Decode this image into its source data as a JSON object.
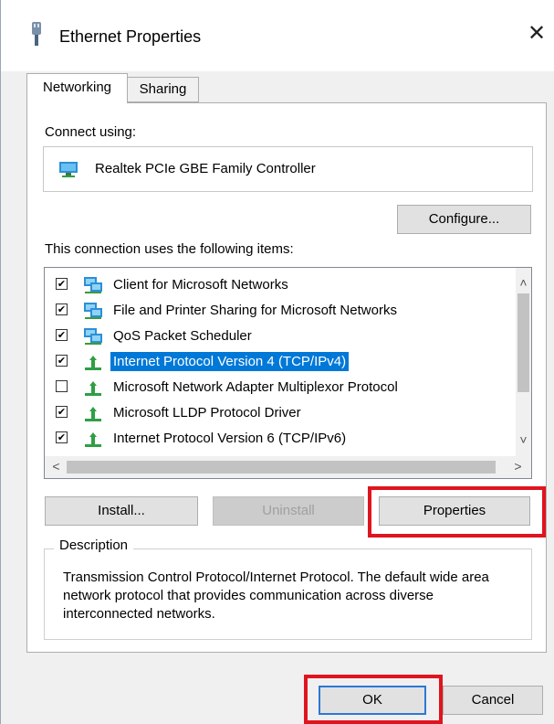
{
  "window": {
    "title": "Ethernet Properties",
    "close_symbol": "✕"
  },
  "tabs": [
    {
      "label": "Networking",
      "active": true
    },
    {
      "label": "Sharing",
      "active": false
    }
  ],
  "networking": {
    "connect_using_label": "Connect using:",
    "adapter_name": "Realtek PCIe GBE Family Controller",
    "configure_label": "Configure...",
    "items_label": "This connection uses the following items:",
    "items": [
      {
        "label": "Client for Microsoft Networks",
        "checked": true,
        "icon": "network-client-icon",
        "selected": false
      },
      {
        "label": "File and Printer Sharing for Microsoft Networks",
        "checked": true,
        "icon": "network-service-icon",
        "selected": false
      },
      {
        "label": "QoS Packet Scheduler",
        "checked": true,
        "icon": "network-service-icon",
        "selected": false
      },
      {
        "label": "Internet Protocol Version 4 (TCP/IPv4)",
        "checked": true,
        "icon": "protocol-icon",
        "selected": true
      },
      {
        "label": "Microsoft Network Adapter Multiplexor Protocol",
        "checked": false,
        "icon": "protocol-icon",
        "selected": false
      },
      {
        "label": "Microsoft LLDP Protocol Driver",
        "checked": true,
        "icon": "protocol-icon",
        "selected": false
      },
      {
        "label": "Internet Protocol Version 6 (TCP/IPv6)",
        "checked": true,
        "icon": "protocol-icon",
        "selected": false
      }
    ],
    "install_label": "Install...",
    "uninstall_label": "Uninstall",
    "properties_label": "Properties",
    "description_title": "Description",
    "description_text": "Transmission Control Protocol/Internet Protocol. The default wide area network protocol that provides communication across diverse interconnected networks."
  },
  "footer": {
    "ok_label": "OK",
    "cancel_label": "Cancel"
  },
  "colors": {
    "selection": "#0078d7",
    "highlight_box": "#e0141e",
    "focus_border": "#2b78d4"
  }
}
